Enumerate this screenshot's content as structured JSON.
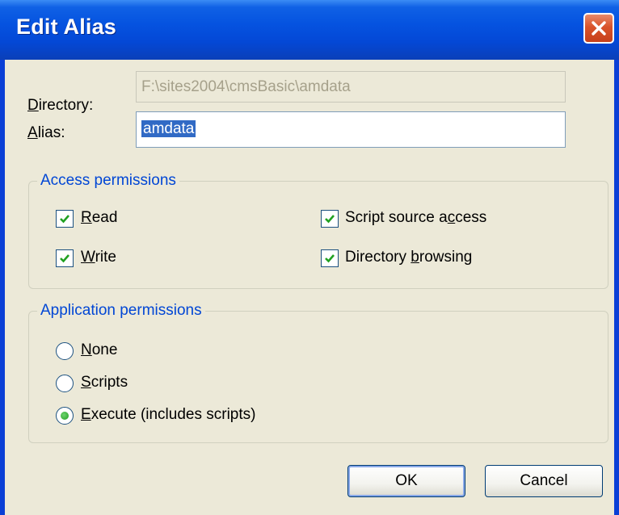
{
  "window": {
    "title": "Edit Alias"
  },
  "form": {
    "directory": {
      "label_prefix": "",
      "label_accel": "D",
      "label_rest": "irectory:",
      "value": "F:\\sites2004\\cmsBasic\\amdata"
    },
    "alias": {
      "label_accel": "A",
      "label_rest": "lias:",
      "value": "amdata"
    }
  },
  "access": {
    "title": "Access permissions",
    "read": {
      "accel": "R",
      "rest": "ead",
      "checked": true
    },
    "write": {
      "accel": "W",
      "rest": "rite",
      "checked": true
    },
    "script_source": {
      "pre": "Script source a",
      "accel": "c",
      "rest": "cess",
      "checked": true
    },
    "dir_browsing": {
      "pre": "Directory ",
      "accel": "b",
      "rest": "rowsing",
      "checked": true
    }
  },
  "application": {
    "title": "Application permissions",
    "none": {
      "accel": "N",
      "rest": "one",
      "selected": false
    },
    "scripts": {
      "accel": "S",
      "rest": "cripts",
      "selected": false
    },
    "execute": {
      "accel": "E",
      "rest": "xecute (includes scripts)",
      "selected": true
    }
  },
  "buttons": {
    "ok": "OK",
    "cancel": "Cancel"
  },
  "icons": {
    "close": "close-icon",
    "check": "checkmark-icon",
    "radio_dot": "radio-dot-icon"
  },
  "colors": {
    "titlebar": "#0553e0",
    "close": "#d9532b",
    "group_title": "#0046d5",
    "check": "#21a121",
    "selection": "#316ac5"
  }
}
